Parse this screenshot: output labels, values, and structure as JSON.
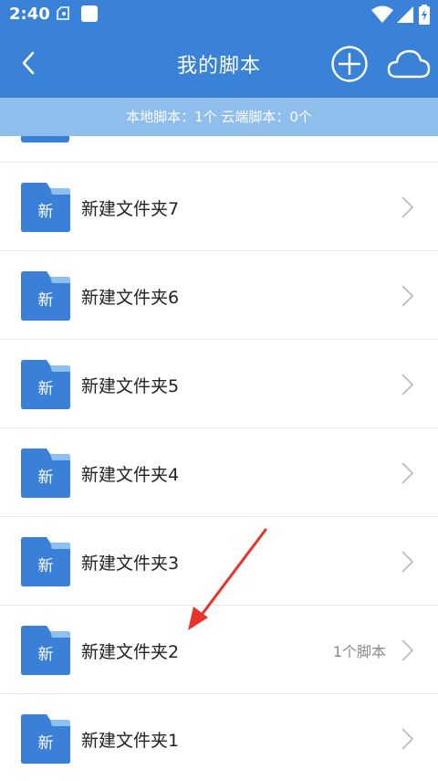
{
  "status_bar": {
    "time": "2:40"
  },
  "header": {
    "title": "我的脚本"
  },
  "summary": {
    "text": "本地脚本：1个 云端脚本：0个"
  },
  "folders": [
    {
      "name": "新建文件夹7",
      "badge": "新",
      "count": ""
    },
    {
      "name": "新建文件夹6",
      "badge": "新",
      "count": ""
    },
    {
      "name": "新建文件夹5",
      "badge": "新",
      "count": ""
    },
    {
      "name": "新建文件夹4",
      "badge": "新",
      "count": ""
    },
    {
      "name": "新建文件夹3",
      "badge": "新",
      "count": ""
    },
    {
      "name": "新建文件夹2",
      "badge": "新",
      "count": "1个脚本"
    },
    {
      "name": "新建文件夹1",
      "badge": "新",
      "count": ""
    }
  ],
  "colors": {
    "primary": "#3a82d8",
    "summary_bar": "#8fbdec",
    "annotation_arrow": "#e8332b"
  }
}
